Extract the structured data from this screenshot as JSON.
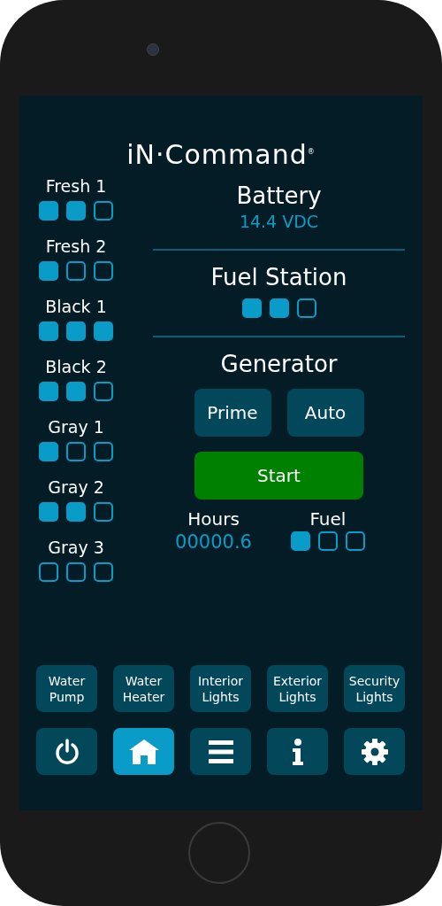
{
  "logo": "iN·Command$^{®}$",
  "tanks": [
    {
      "name": "Fresh 1",
      "cells": [
        {
          "on": true
        },
        {
          "on": true
        },
        {
          "on": false
        }
      ]
    },
    {
      "name": "Fresh 2",
      "cells": [
        {
          "on": true
        },
        {
          "on": false
        },
        {
          "on": false
        }
      ]
    },
    {
      "name": "Black 1",
      "cells": [
        {
          "on": true
        },
        {
          "on": true
        },
        {
          "on": true
        }
      ]
    },
    {
      "name": "Black 2",
      "cells": [
        {
          "on": true
        },
        {
          "on": true
        },
        {
          "on": false
        }
      ]
    },
    {
      "name": "Gray 1",
      "cells": [
        {
          "on": true
        },
        {
          "on": false
        },
        {
          "on": false
        }
      ]
    },
    {
      "name": "Gray 2",
      "cells": [
        {
          "on": true
        },
        {
          "on": true
        },
        {
          "on": false
        }
      ]
    },
    {
      "name": "Gray 3",
      "cells": [
        {
          "on": false
        },
        {
          "on": false
        },
        {
          "on": false
        }
      ]
    }
  ],
  "battery": {
    "title": "Battery",
    "value": "14.4 VDC"
  },
  "fuel_station": {
    "title": "Fuel Station",
    "cells": [
      {
        "on": true
      },
      {
        "on": true
      },
      {
        "on": false
      }
    ]
  },
  "generator": {
    "title": "Generator",
    "buttons": [
      "Prime",
      "Auto"
    ],
    "start": "Start",
    "hours_label": "Hours",
    "hours": "00000.6",
    "fuel_label": "Fuel",
    "fuel_cells": [
      {
        "on": true
      },
      {
        "on": false
      },
      {
        "on": false
      }
    ]
  },
  "switches": [
    {
      "line1": "Water",
      "line2": "Pump"
    },
    {
      "line1": "Water",
      "line2": "Heater"
    },
    {
      "line1": "Interior",
      "line2": "Lights"
    },
    {
      "line1": "Exterior",
      "line2": "Lights"
    },
    {
      "line1": "Security",
      "line2": "Lights"
    }
  ],
  "nav": [
    {
      "kind": "power",
      "selected": false
    },
    {
      "kind": "home",
      "selected": true
    },
    {
      "kind": "menu",
      "selected": false
    },
    {
      "kind": "info",
      "selected": false
    },
    {
      "kind": "settings",
      "selected": false
    }
  ]
}
